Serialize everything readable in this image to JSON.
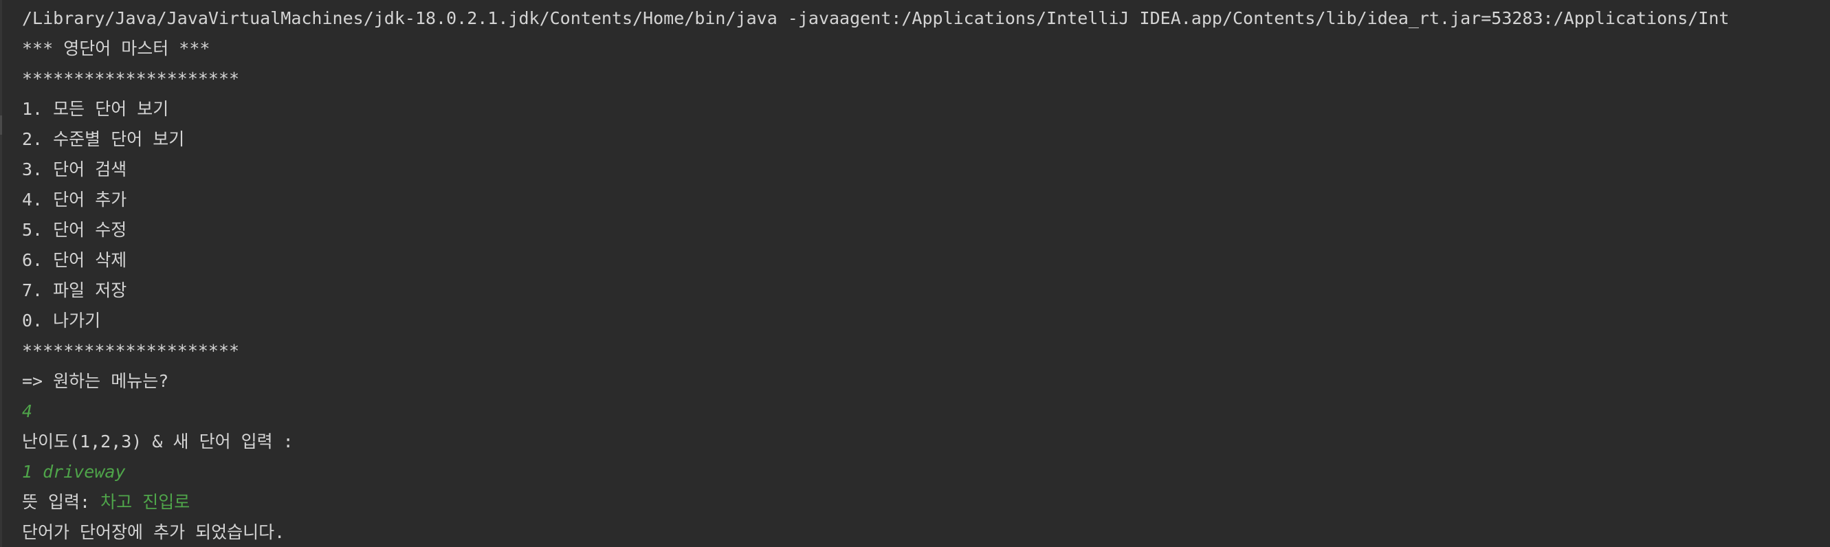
{
  "console": {
    "command": "/Library/Java/JavaVirtualMachines/jdk-18.0.2.1.jdk/Contents/Home/bin/java -javaagent:/Applications/IntelliJ IDEA.app/Contents/lib/idea_rt.jar=53283:/Applications/Int",
    "title": "*** 영단어 마스터 ***",
    "separator": "*********************",
    "menu_items": [
      "1. 모든 단어 보기",
      "2. 수준별 단어 보기",
      "3. 단어 검색",
      "4. 단어 추가",
      "5. 단어 수정",
      "6. 단어 삭제",
      "7. 파일 저장",
      "0. 나가기"
    ],
    "prompt_menu": "=> 원하는 메뉴는?",
    "input_menu": "4",
    "prompt_level_word": "난이도(1,2,3) & 새 단어 입력 :",
    "input_level_word": "1 driveway",
    "prompt_meaning": "뜻 입력: ",
    "input_meaning": "차고 진입로",
    "result": "단어가 단어장에 추가 되었습니다.",
    "colors": {
      "background": "#2b2b2b",
      "output_text": "#d4d4d4",
      "user_input": "#4fa54a"
    }
  }
}
